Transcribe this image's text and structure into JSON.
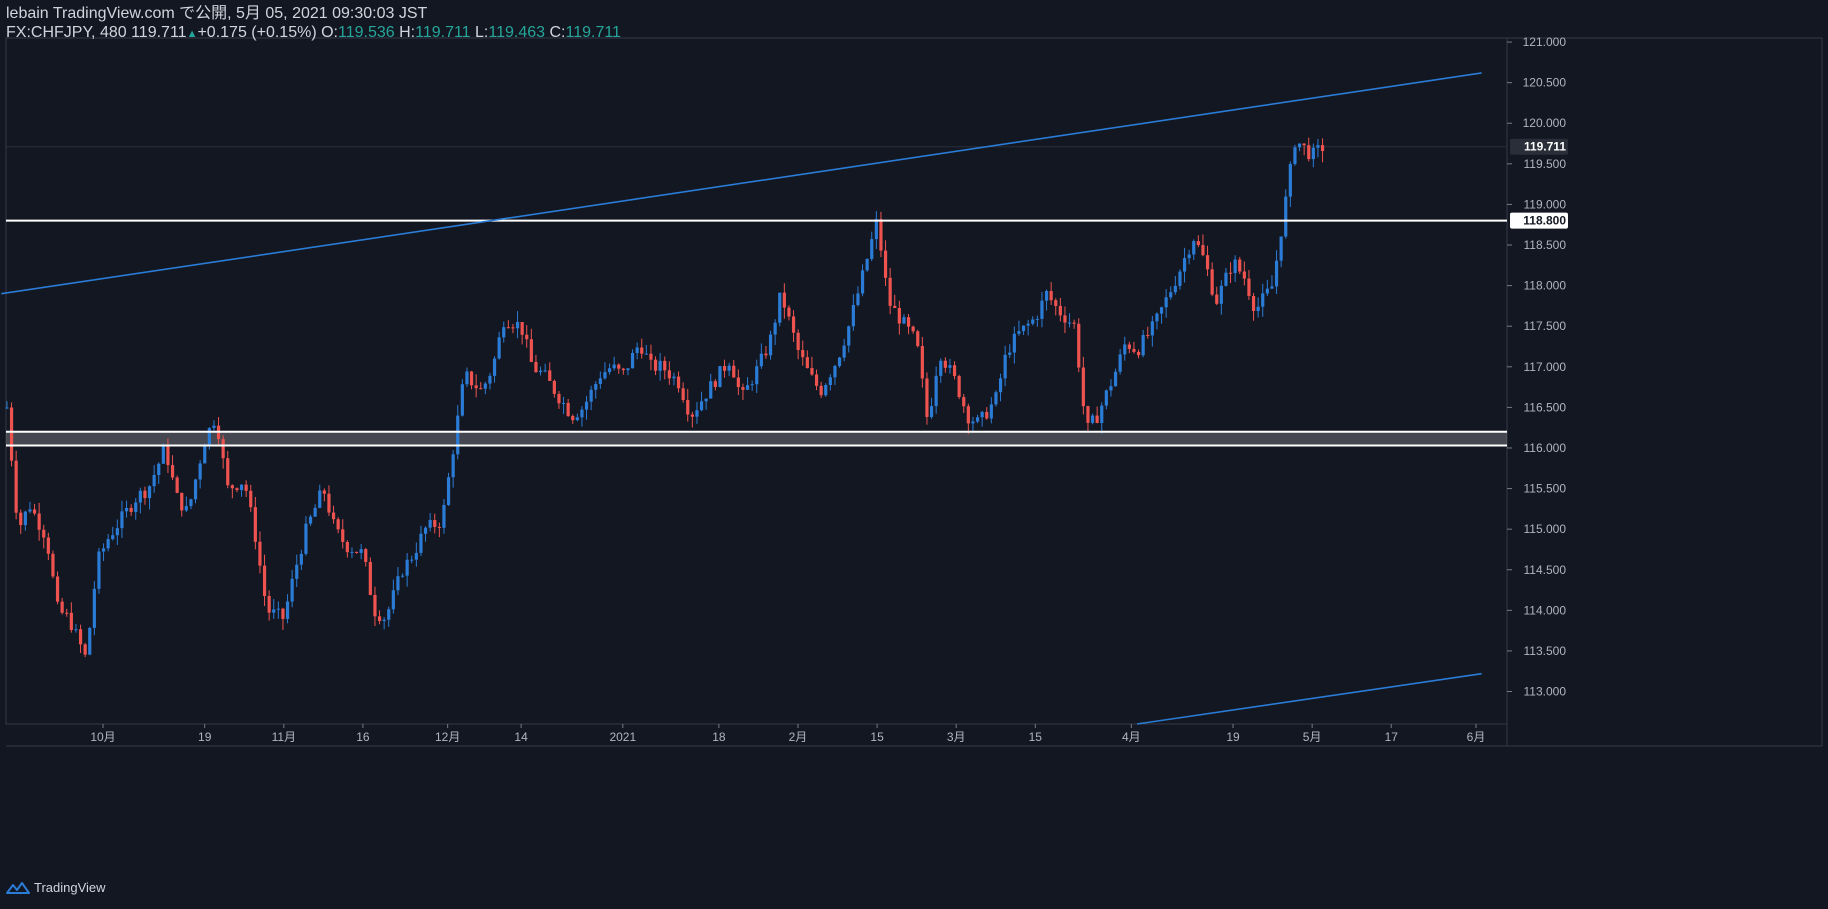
{
  "header": {
    "publish_line": "lebain TradingView.com で公開, 5月 05, 2021 09:30:03 JST",
    "symbol": "FX:CHFJPY, 480",
    "last": "119.711",
    "change": "+0.175 (+0.15%)",
    "o_label": "O:",
    "o_value": "119.536",
    "h_label": "H:",
    "h_value": "119.711",
    "l_label": "L:",
    "l_value": "119.463",
    "c_label": "C:",
    "c_value": "119.711"
  },
  "footer": {
    "brand": "TradingView"
  },
  "colors": {
    "background": "#131722",
    "up": "#2a7cd6",
    "down": "#ef5350",
    "trendline": "#2a7cd6",
    "level": "#ffffff",
    "value": "#26a69a"
  },
  "chart_data": {
    "type": "candlestick",
    "symbol": "FX:CHFJPY",
    "interval": "480",
    "ylim": [
      112.6,
      121.05
    ],
    "y_ticks": [
      "113.000",
      "113.500",
      "114.000",
      "114.500",
      "115.000",
      "115.500",
      "116.000",
      "116.500",
      "117.000",
      "117.500",
      "118.000",
      "118.500",
      "119.000",
      "119.500",
      "120.000",
      "120.500",
      "121.000"
    ],
    "x_ticks": [
      {
        "label": "10月",
        "date": "2020-10-01"
      },
      {
        "label": "19",
        "date": "2020-10-19"
      },
      {
        "label": "11月",
        "date": "2020-11-02"
      },
      {
        "label": "16",
        "date": "2020-11-16"
      },
      {
        "label": "12月",
        "date": "2020-12-01"
      },
      {
        "label": "14",
        "date": "2020-12-14"
      },
      {
        "label": "2021",
        "date": "2021-01-01"
      },
      {
        "label": "18",
        "date": "2021-01-18"
      },
      {
        "label": "2月",
        "date": "2021-02-01"
      },
      {
        "label": "15",
        "date": "2021-02-15"
      },
      {
        "label": "3月",
        "date": "2021-03-01"
      },
      {
        "label": "15",
        "date": "2021-03-15"
      },
      {
        "label": "4月",
        "date": "2021-04-01"
      },
      {
        "label": "19",
        "date": "2021-04-19"
      },
      {
        "label": "5月",
        "date": "2021-05-03"
      },
      {
        "label": "17",
        "date": "2021-05-17"
      },
      {
        "label": "6月",
        "date": "2021-06-01"
      }
    ],
    "close_path": [
      [
        "2020-09-14",
        116.5
      ],
      [
        "2020-09-16",
        115.0
      ],
      [
        "2020-09-18",
        115.3
      ],
      [
        "2020-09-21",
        114.9
      ],
      [
        "2020-09-23",
        114.0
      ],
      [
        "2020-09-25",
        113.9
      ],
      [
        "2020-09-28",
        113.4
      ],
      [
        "2020-09-30",
        114.6
      ],
      [
        "2020-10-02",
        114.9
      ],
      [
        "2020-10-05",
        115.2
      ],
      [
        "2020-10-07",
        115.4
      ],
      [
        "2020-10-09",
        115.5
      ],
      [
        "2020-10-12",
        116.0
      ],
      [
        "2020-10-14",
        115.4
      ],
      [
        "2020-10-16",
        115.2
      ],
      [
        "2020-10-19",
        116.1
      ],
      [
        "2020-10-21",
        116.4
      ],
      [
        "2020-10-23",
        115.5
      ],
      [
        "2020-10-26",
        115.6
      ],
      [
        "2020-10-28",
        114.9
      ],
      [
        "2020-10-30",
        114.0
      ],
      [
        "2020-11-02",
        113.9
      ],
      [
        "2020-11-04",
        114.5
      ],
      [
        "2020-11-06",
        115.0
      ],
      [
        "2020-11-09",
        115.5
      ],
      [
        "2020-11-11",
        115.0
      ],
      [
        "2020-11-13",
        114.8
      ],
      [
        "2020-11-16",
        114.7
      ],
      [
        "2020-11-18",
        114.0
      ],
      [
        "2020-11-20",
        113.9
      ],
      [
        "2020-11-23",
        114.5
      ],
      [
        "2020-11-25",
        114.7
      ],
      [
        "2020-11-27",
        115.0
      ],
      [
        "2020-11-30",
        115.1
      ],
      [
        "2020-12-02",
        116.0
      ],
      [
        "2020-12-04",
        116.9
      ],
      [
        "2020-12-07",
        116.7
      ],
      [
        "2020-12-09",
        117.0
      ],
      [
        "2020-12-11",
        117.6
      ],
      [
        "2020-12-14",
        117.5
      ],
      [
        "2020-12-16",
        117.0
      ],
      [
        "2020-12-18",
        116.9
      ],
      [
        "2020-12-21",
        116.6
      ],
      [
        "2020-12-23",
        116.4
      ],
      [
        "2020-12-25",
        116.5
      ],
      [
        "2020-12-28",
        116.9
      ],
      [
        "2020-12-30",
        117.0
      ],
      [
        "2021-01-01",
        116.9
      ],
      [
        "2021-01-04",
        117.3
      ],
      [
        "2021-01-06",
        117.0
      ],
      [
        "2021-01-08",
        117.0
      ],
      [
        "2021-01-11",
        116.8
      ],
      [
        "2021-01-13",
        116.4
      ],
      [
        "2021-01-15",
        116.6
      ],
      [
        "2021-01-18",
        116.9
      ],
      [
        "2021-01-20",
        117.1
      ],
      [
        "2021-01-22",
        116.6
      ],
      [
        "2021-01-25",
        117.0
      ],
      [
        "2021-01-27",
        117.3
      ],
      [
        "2021-01-29",
        117.9
      ],
      [
        "2021-02-01",
        117.2
      ],
      [
        "2021-02-03",
        116.9
      ],
      [
        "2021-02-05",
        116.7
      ],
      [
        "2021-02-08",
        117.1
      ],
      [
        "2021-02-10",
        117.5
      ],
      [
        "2021-02-12",
        118.0
      ],
      [
        "2021-02-15",
        118.8
      ],
      [
        "2021-02-17",
        117.8
      ],
      [
        "2021-02-19",
        117.6
      ],
      [
        "2021-02-22",
        117.3
      ],
      [
        "2021-02-24",
        116.3
      ],
      [
        "2021-02-26",
        117.2
      ],
      [
        "2021-03-01",
        116.8
      ],
      [
        "2021-03-03",
        116.4
      ],
      [
        "2021-03-05",
        116.3
      ],
      [
        "2021-03-08",
        116.6
      ],
      [
        "2021-03-10",
        117.2
      ],
      [
        "2021-03-12",
        117.4
      ],
      [
        "2021-03-15",
        117.6
      ],
      [
        "2021-03-17",
        117.9
      ],
      [
        "2021-03-19",
        117.7
      ],
      [
        "2021-03-22",
        117.5
      ],
      [
        "2021-03-24",
        116.2
      ],
      [
        "2021-03-26",
        116.4
      ],
      [
        "2021-03-29",
        116.9
      ],
      [
        "2021-03-31",
        117.3
      ],
      [
        "2021-04-02",
        117.2
      ],
      [
        "2021-04-05",
        117.5
      ],
      [
        "2021-04-07",
        117.8
      ],
      [
        "2021-04-09",
        118.1
      ],
      [
        "2021-04-12",
        118.6
      ],
      [
        "2021-04-14",
        118.3
      ],
      [
        "2021-04-16",
        117.8
      ],
      [
        "2021-04-19",
        118.3
      ],
      [
        "2021-04-21",
        118.1
      ],
      [
        "2021-04-23",
        117.7
      ],
      [
        "2021-04-26",
        118.0
      ],
      [
        "2021-04-28",
        118.9
      ],
      [
        "2021-04-30",
        119.8
      ],
      [
        "2021-05-03",
        119.6
      ],
      [
        "2021-05-05",
        119.711
      ]
    ],
    "horizontal_levels": [
      118.8,
      116.2,
      116.03
    ],
    "support_zone": [
      116.03,
      116.2
    ],
    "trendlines": [
      {
        "from": [
          "2020-09-13",
          117.9
        ],
        "to": [
          "2021-06-02",
          120.62
        ]
      },
      {
        "from": [
          "2021-04-02",
          112.6
        ],
        "to": [
          "2021-06-02",
          113.22
        ]
      }
    ],
    "price_labels": [
      {
        "text": "119.711",
        "value": 119.711,
        "style": "last"
      },
      {
        "text": "118.800",
        "value": 118.8,
        "style": "level"
      }
    ]
  }
}
